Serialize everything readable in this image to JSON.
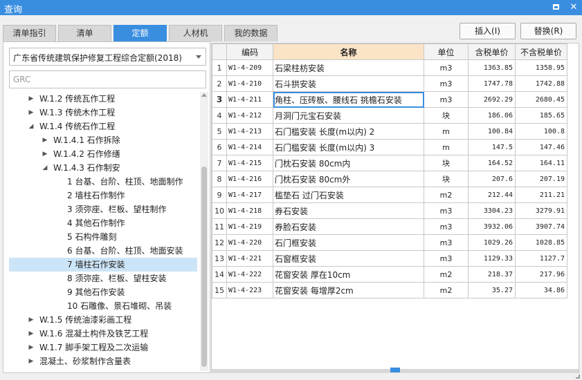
{
  "window": {
    "title": "查询"
  },
  "tabs": [
    {
      "label": "清单指引",
      "active": false
    },
    {
      "label": "清单",
      "active": false
    },
    {
      "label": "定额",
      "active": true
    },
    {
      "label": "人材机",
      "active": false
    },
    {
      "label": "我的数据",
      "active": false
    }
  ],
  "buttons": {
    "insert": "插入(I)",
    "replace": "替换(R)"
  },
  "left": {
    "library_select": "广东省传统建筑保护修复工程综合定额(2018)",
    "search_value": "",
    "search_placeholder": "GRC",
    "tree": [
      {
        "label": "W.1.2 传统瓦作工程",
        "toggle": "collapsed",
        "level": 1
      },
      {
        "label": "W.1.3 传统木作工程",
        "toggle": "collapsed",
        "level": 1
      },
      {
        "label": "W.1.4 传统石作工程",
        "toggle": "expanded",
        "level": 1
      },
      {
        "label": "W.1.4.1 石作拆除",
        "toggle": "collapsed",
        "level": 2
      },
      {
        "label": "W.1.4.2 石作修缮",
        "toggle": "collapsed",
        "level": 2
      },
      {
        "label": "W.1.4.3 石作制安",
        "toggle": "expanded",
        "level": 2
      },
      {
        "label": "1 台基、台阶、柱顶、地面制作",
        "toggle": "none",
        "level": 3
      },
      {
        "label": "2 墙柱石作制作",
        "toggle": "none",
        "level": 3
      },
      {
        "label": "3 须弥座、栏板、望柱制作",
        "toggle": "none",
        "level": 3
      },
      {
        "label": "4 其他石作制作",
        "toggle": "none",
        "level": 3
      },
      {
        "label": "5 石构件雕刻",
        "toggle": "none",
        "level": 3
      },
      {
        "label": "6 台基、台阶、柱顶、地面安装",
        "toggle": "none",
        "level": 3
      },
      {
        "label": "7 墙柱石作安装",
        "toggle": "none",
        "level": 3,
        "selected": true
      },
      {
        "label": "8 须弥座、栏板、望柱安装",
        "toggle": "none",
        "level": 3
      },
      {
        "label": "9 其他石作安装",
        "toggle": "none",
        "level": 3
      },
      {
        "label": "10 石雕像、景石堆砌、吊装",
        "toggle": "none",
        "level": 3
      },
      {
        "label": "W.1.5 传统油漆彩画工程",
        "toggle": "collapsed",
        "level": 1
      },
      {
        "label": "W.1.6 混凝土构件及铁艺工程",
        "toggle": "collapsed",
        "level": 1
      },
      {
        "label": "W.1.7 脚手架工程及二次运输",
        "toggle": "collapsed",
        "level": 1
      },
      {
        "label": "混凝土、砂浆制作含量表",
        "toggle": "collapsed",
        "level": 1
      }
    ]
  },
  "table": {
    "headers": {
      "code": "编码",
      "name": "名称",
      "unit": "单位",
      "price_tax": "含税单价",
      "price_notax": "不含税单价"
    },
    "rows": [
      {
        "idx": "1",
        "code": "W1-4-209",
        "name": "石梁柱枋安装",
        "unit": "m3",
        "price_tax": "1363.85",
        "price_notax": "1358.95"
      },
      {
        "idx": "2",
        "code": "W1-4-210",
        "name": "石斗拱安装",
        "unit": "m3",
        "price_tax": "1747.78",
        "price_notax": "1742.88"
      },
      {
        "idx": "3",
        "code": "W1-4-211",
        "name": "角柱、压砖板、腰线石 挑檐石安装",
        "unit": "m3",
        "price_tax": "2692.29",
        "price_notax": "2680.45"
      },
      {
        "idx": "4",
        "code": "W1-4-212",
        "name": "月洞门元宝石安装",
        "unit": "块",
        "price_tax": "186.06",
        "price_notax": "185.65"
      },
      {
        "idx": "5",
        "code": "W1-4-213",
        "name": "石门槛安装 长度(m以内) 2",
        "unit": "m",
        "price_tax": "100.84",
        "price_notax": "100.8"
      },
      {
        "idx": "6",
        "code": "W1-4-214",
        "name": "石门槛安装 长度(m以内) 3",
        "unit": "m",
        "price_tax": "147.5",
        "price_notax": "147.46"
      },
      {
        "idx": "7",
        "code": "W1-4-215",
        "name": "门枕石安装 80cm内",
        "unit": "块",
        "price_tax": "164.52",
        "price_notax": "164.11"
      },
      {
        "idx": "8",
        "code": "W1-4-216",
        "name": "门枕石安装 80cm外",
        "unit": "块",
        "price_tax": "207.6",
        "price_notax": "207.19"
      },
      {
        "idx": "9",
        "code": "W1-4-217",
        "name": "槛垫石 过门石安装",
        "unit": "m2",
        "price_tax": "212.44",
        "price_notax": "211.21"
      },
      {
        "idx": "10",
        "code": "W1-4-218",
        "name": "券石安装",
        "unit": "m3",
        "price_tax": "3304.23",
        "price_notax": "3279.91"
      },
      {
        "idx": "11",
        "code": "W1-4-219",
        "name": "券脸石安装",
        "unit": "m3",
        "price_tax": "3932.06",
        "price_notax": "3907.74"
      },
      {
        "idx": "12",
        "code": "W1-4-220",
        "name": "石门框安装",
        "unit": "m3",
        "price_tax": "1029.26",
        "price_notax": "1028.85"
      },
      {
        "idx": "13",
        "code": "W1-4-221",
        "name": "石窗框安装",
        "unit": "m3",
        "price_tax": "1129.33",
        "price_notax": "1127.7"
      },
      {
        "idx": "14",
        "code": "W1-4-222",
        "name": "花窗安装 厚在10cm",
        "unit": "m2",
        "price_tax": "218.37",
        "price_notax": "217.96"
      },
      {
        "idx": "15",
        "code": "W1-4-223",
        "name": "花窗安装 每增厚2cm",
        "unit": "m2",
        "price_tax": "35.27",
        "price_notax": "34.86"
      }
    ],
    "current_row": "3"
  },
  "colors": {
    "accent": "#3a8ee0",
    "selected_row": "#cce4f7",
    "name_header": "#fbe3c6"
  }
}
